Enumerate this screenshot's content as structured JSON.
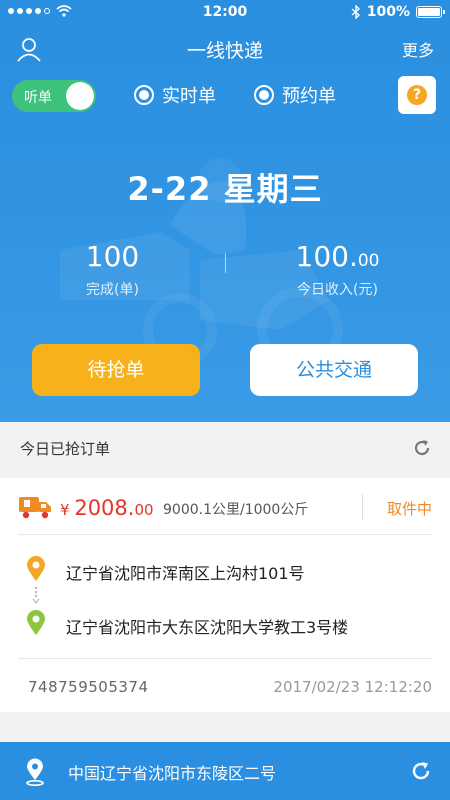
{
  "status_bar": {
    "time": "12:00",
    "battery": "100%"
  },
  "nav": {
    "title": "一线快递",
    "more": "更多",
    "user_icon": "user-icon"
  },
  "mode": {
    "listen_label": "听单",
    "listen_on": true,
    "options": [
      {
        "label": "实时单",
        "selected": true
      },
      {
        "label": "预约单",
        "selected": true
      }
    ],
    "help_icon": "?"
  },
  "summary": {
    "date": "2-22 星期三",
    "completed_value": "100",
    "completed_label": "完成(单)",
    "income_int": "100.",
    "income_dec": "00",
    "income_label": "今日收入(元)"
  },
  "actions": {
    "grab": "待抢单",
    "transit": "公共交通"
  },
  "section": {
    "title": "今日已抢订单"
  },
  "order": {
    "currency": "¥",
    "price_int": "2008.",
    "price_dec": "00",
    "distance_weight": "9000.1公里/1000公斤",
    "status": "取件中",
    "from": "辽宁省沈阳市浑南区上沟村101号",
    "to": "辽宁省沈阳市大东区沈阳大学教工3号楼",
    "order_no": "748759505374",
    "time": "2017/02/23 12:12:20"
  },
  "location": {
    "text": "中国辽宁省沈阳市东陵区二号"
  },
  "colors": {
    "primary": "#2a8fe0",
    "accent": "#f7b21b",
    "price": "#e5352a",
    "status": "#f08a24",
    "toggle": "#3cc27a"
  }
}
